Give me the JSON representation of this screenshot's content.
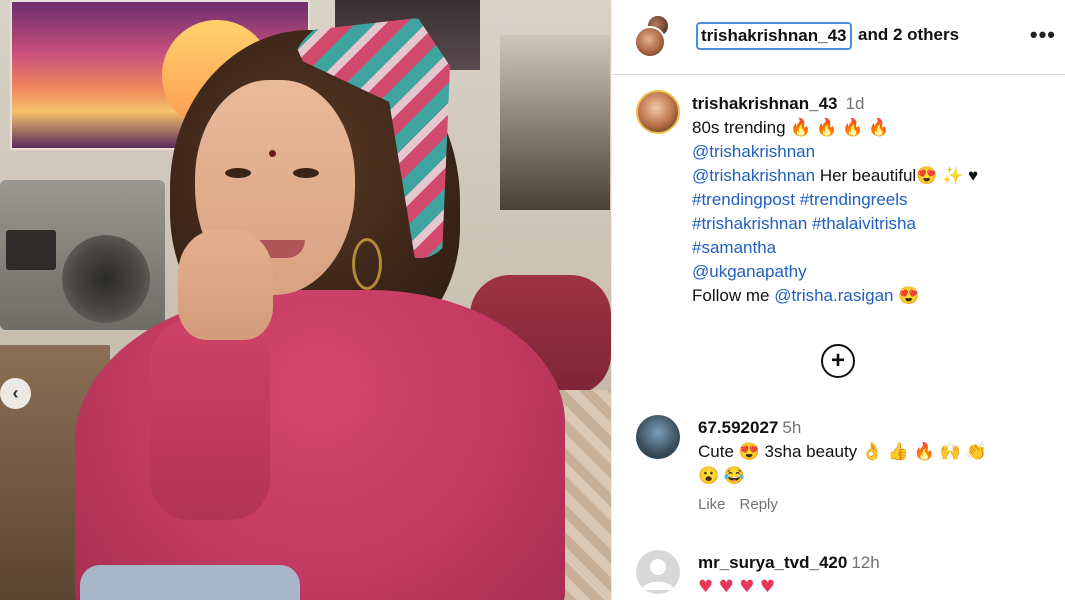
{
  "post": {
    "owner_username": "trishakrishnan_43",
    "collaborators_text": "and 2 others",
    "more_label": "•••",
    "carousel_prev_label": "‹"
  },
  "caption": {
    "username": "trishakrishnan_43",
    "time": "1d",
    "line1_text": "80s trending",
    "mention1": "@trishakrishnan",
    "mention2": "@trishakrishnan",
    "line3_text": " Her beautiful",
    "hashtag1": "#trendingpost",
    "hashtag2": "#trendingreels",
    "hashtag3": "#trishakrishnan",
    "hashtag4": "#thalaivitrisha",
    "hashtag5": "#samantha",
    "mention3": "@ukganapathy",
    "follow_text": "Follow me ",
    "mention4": "@trisha.rasigan"
  },
  "load_more_label": "+",
  "comments": [
    {
      "username": "67.592027",
      "time": "5h",
      "text_a": "Cute ",
      "text_b": " 3sha beauty ",
      "like_label": "Like",
      "reply_label": "Reply"
    },
    {
      "username": "mr_surya_tvd_420",
      "time": "12h",
      "hearts": "♥ ♥ ♥ ♥"
    }
  ],
  "icons": {
    "fire": "🔥",
    "heart_eyes": "😍",
    "sparkles": "✨",
    "black_heart": "♥",
    "ok_hand": "👌",
    "thumbs_up": "👍",
    "raised_hands": "🙌",
    "clap": "👏",
    "surprised": "😮",
    "laughing": "😂"
  },
  "colors": {
    "link": "#00376b",
    "hashtag": "#1f5fbf",
    "focus_ring": "#4b8fe0",
    "muted_text": "#737373",
    "heart": "#e8375a"
  }
}
